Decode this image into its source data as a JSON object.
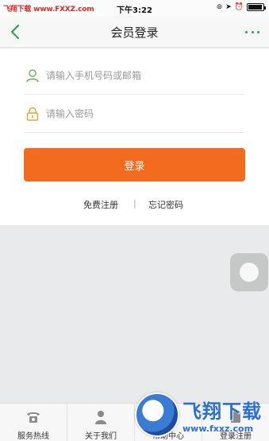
{
  "status_bar": {
    "carrier": "飞翔下载 www.FXXZ.com",
    "time": "下午3:22"
  },
  "header": {
    "title": "会员登录"
  },
  "form": {
    "phone_placeholder": "请输入手机号码或邮箱",
    "password_placeholder": "请输入密码",
    "login_label": "登录"
  },
  "links": {
    "register": "免费注册",
    "separator": "|",
    "forgot": "忘记密码"
  },
  "tabs": [
    {
      "label": "服务热线",
      "icon": "phone-icon"
    },
    {
      "label": "关于我们",
      "icon": "user-icon"
    },
    {
      "label": "帮助中心",
      "icon": "help-icon"
    },
    {
      "label": "登录注册",
      "icon": "login-icon"
    }
  ],
  "watermark": {
    "brand": "飞翔下载",
    "url": "www.fxxz.com"
  },
  "colors": {
    "accent_green": "#2aa34a",
    "login_orange": "#f26b1f",
    "background": "#e9eaec"
  }
}
